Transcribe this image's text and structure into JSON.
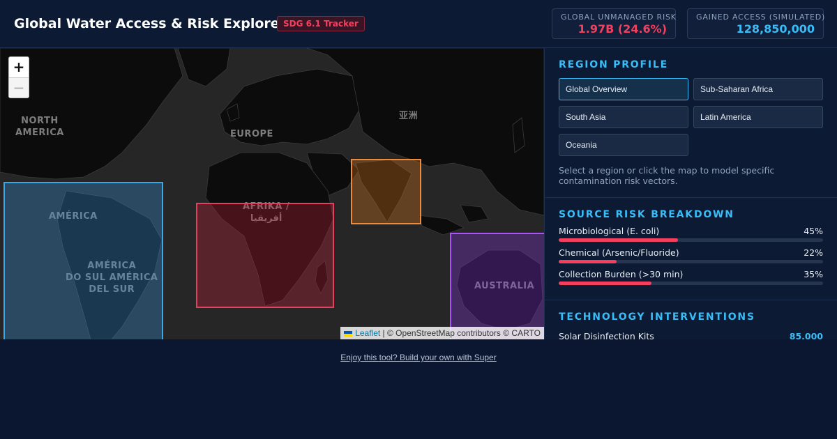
{
  "header": {
    "title": "Global Water Access & Risk Explorer",
    "badge": "SDG 6.1 Tracker",
    "stats": [
      {
        "label": "GLOBAL UNMANAGED RISK",
        "value": "1.97B (24.6%)"
      },
      {
        "label": "GAINED ACCESS (SIMULATED)",
        "value": "128,850,000"
      }
    ]
  },
  "map": {
    "zoom_in": "+",
    "zoom_out": "−",
    "labels": {
      "north_america": "NORTH\nAMERICA",
      "europe": "EUROPE",
      "asia": "亚洲",
      "africa": "AFRIKA /\nأفريقيا",
      "america": "AMÉRICA",
      "south_america": "AMÉRICA\nDO SUL AMÉRICA\nDEL SUR",
      "australia": "AUSTRALIA"
    },
    "attribution": {
      "leaflet": "Leaflet",
      "rest": " | © OpenStreetMap contributors © CARTO"
    },
    "colors": {
      "latin_america": "#3da6e6",
      "sub_saharan_africa": "#e64060",
      "south_asia": "#f08a3a",
      "oceania": "#a855f7"
    }
  },
  "panel": {
    "region_profile": {
      "title": "REGION PROFILE",
      "regions": [
        "Global Overview",
        "Sub-Saharan Africa",
        "South Asia",
        "Latin America",
        "Oceania"
      ],
      "active": "Global Overview",
      "hint": "Select a region or click the map to model specific contamination risk vectors."
    },
    "source_risk": {
      "title": "SOURCE RISK BREAKDOWN",
      "items": [
        {
          "label": "Microbiological (E. coli)",
          "percent": 45,
          "display": "45%"
        },
        {
          "label": "Chemical (Arsenic/Fluoride)",
          "percent": 22,
          "display": "22%"
        },
        {
          "label": "Collection Burden (>30 min)",
          "percent": 35,
          "display": "35%"
        }
      ]
    },
    "interventions": {
      "title": "TECHNOLOGY INTERVENTIONS",
      "items": [
        {
          "label": "Solar Disinfection Kits",
          "value": "85,000"
        }
      ]
    }
  },
  "footer": {
    "link": "Enjoy this tool? Build your own with Super"
  }
}
